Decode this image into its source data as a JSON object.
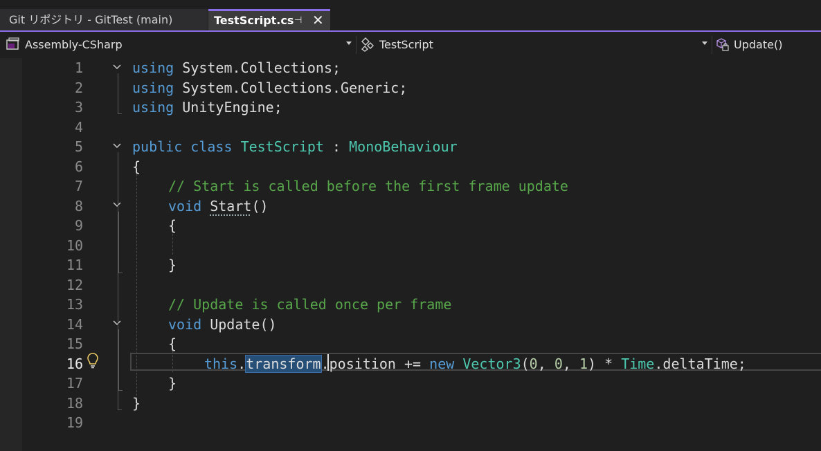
{
  "tabs": [
    {
      "label": "Git リポジトリ - GitTest (main)",
      "active": false
    },
    {
      "label": "TestScript.cs",
      "active": true
    }
  ],
  "tab_icons": {
    "pin": "pin-icon",
    "close": "close-icon"
  },
  "navbar": {
    "project": "Assembly-CSharp",
    "class": "TestScript",
    "member": "Update()"
  },
  "editor": {
    "current_line": 16,
    "lines": [
      {
        "n": "1"
      },
      {
        "n": "2"
      },
      {
        "n": "3"
      },
      {
        "n": "4"
      },
      {
        "n": "5"
      },
      {
        "n": "6"
      },
      {
        "n": "7"
      },
      {
        "n": "8"
      },
      {
        "n": "9"
      },
      {
        "n": "10"
      },
      {
        "n": "11"
      },
      {
        "n": "12"
      },
      {
        "n": "13"
      },
      {
        "n": "14"
      },
      {
        "n": "15"
      },
      {
        "n": "16"
      },
      {
        "n": "17"
      },
      {
        "n": "18"
      },
      {
        "n": "19"
      }
    ],
    "tokens": {
      "using": "using",
      "ns1": "System.Collections;",
      "ns2": "System.Collections.Generic;",
      "ns3": "UnityEngine;",
      "public": "public",
      "class": "class",
      "classname": "TestScript",
      "colon": ":",
      "base": "MonoBehaviour",
      "open_brace": "{",
      "close_brace": "}",
      "comment_start": "// Start is called before the first frame update",
      "void": "void",
      "start": "Start",
      "parens": "()",
      "comment_update": "// Update is called once per frame",
      "update": "Update",
      "this": "this",
      "dot": ".",
      "transform": "transform",
      "position": ".position",
      "plus_eq": "+=",
      "new": "new",
      "vector3": "Vector3",
      "lparen": "(",
      "n0a": "0",
      "comma": ",",
      "n0b": "0",
      "n1": "1",
      "rparen": ")",
      "star": "*",
      "time": "Time",
      "delta": ".deltaTime;"
    }
  },
  "colors": {
    "keyword": "#569cd6",
    "type": "#4ec9b0",
    "comment": "#57a64a",
    "number": "#b5cea8",
    "accent": "#8a6fe8"
  }
}
